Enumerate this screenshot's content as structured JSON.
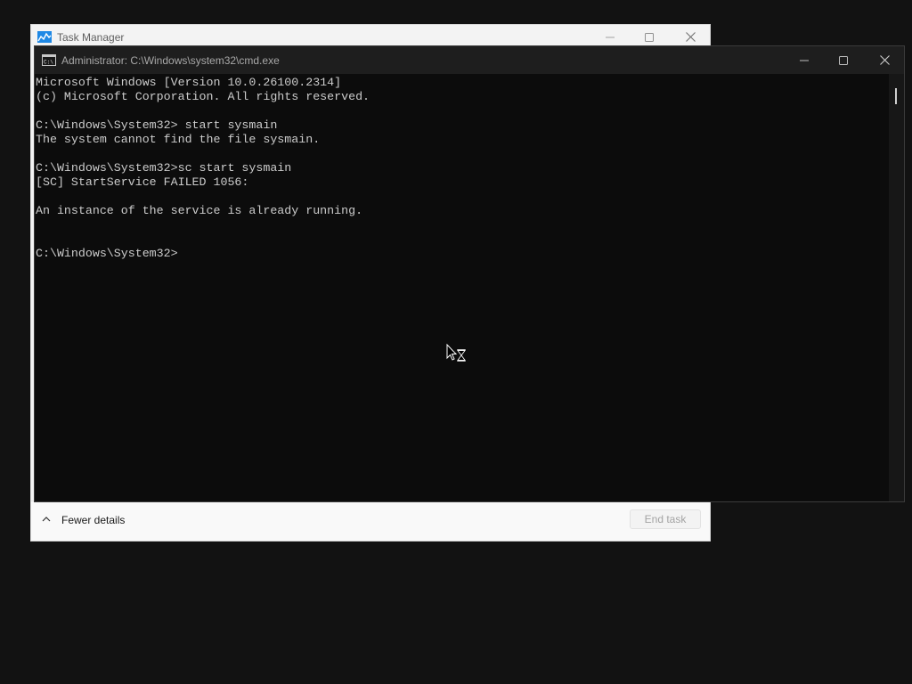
{
  "task_manager": {
    "title": "Task Manager",
    "footer": {
      "fewer_details_label": "Fewer details",
      "end_task_label": "End task"
    },
    "icons": {
      "app": "task-manager-app-icon",
      "minimize": "minimize-icon",
      "maximize": "maximize-icon",
      "close": "close-icon",
      "chevron": "chevron-up-icon"
    }
  },
  "cmd": {
    "title": "Administrator: C:\\Windows\\system32\\cmd.exe",
    "lines": [
      "Microsoft Windows [Version 10.0.26100.2314]",
      "(c) Microsoft Corporation. All rights reserved.",
      "",
      "C:\\Windows\\System32> start sysmain",
      "The system cannot find the file sysmain.",
      "",
      "C:\\Windows\\System32>sc start sysmain",
      "[SC] StartService FAILED 1056:",
      "",
      "An instance of the service is already running.",
      "",
      "",
      "C:\\Windows\\System32>"
    ],
    "icons": {
      "app": "cmd-app-icon",
      "minimize": "minimize-icon",
      "maximize": "maximize-icon",
      "close": "close-icon"
    }
  },
  "cursor": {
    "icon": "busy-cursor-icon"
  },
  "colors": {
    "desktop_bg": "#121212",
    "console_bg": "#0c0c0c",
    "console_text": "#cccccc",
    "cmd_titlebar": "#1e1e1e",
    "task_manager_bg": "#f3f3f3"
  }
}
